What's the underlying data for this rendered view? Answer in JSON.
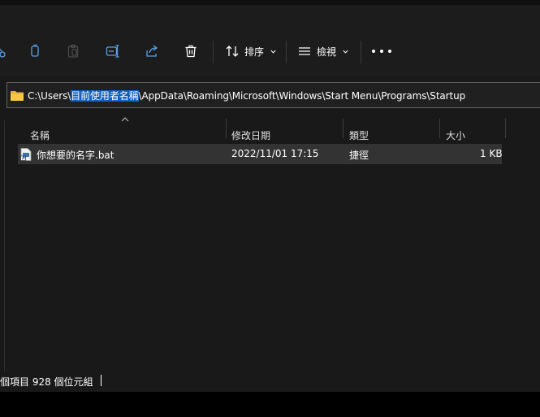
{
  "toolbar": {
    "sort_label": "排序",
    "view_label": "檢視"
  },
  "address": {
    "prefix": "C:\\Users\\",
    "selected": "目前使用者名稱",
    "suffix": "\\AppData\\Roaming\\Microsoft\\Windows\\Start Menu\\Programs\\Startup"
  },
  "columns": {
    "name": "名稱",
    "modified": "修改日期",
    "type": "類型",
    "size": "大小"
  },
  "files": [
    {
      "name": "你想要的名字.bat",
      "modified": "2022/11/01 17:15",
      "type": "捷徑",
      "size": "1 KB"
    }
  ],
  "status": {
    "text": "個項目  928 個位元組"
  }
}
